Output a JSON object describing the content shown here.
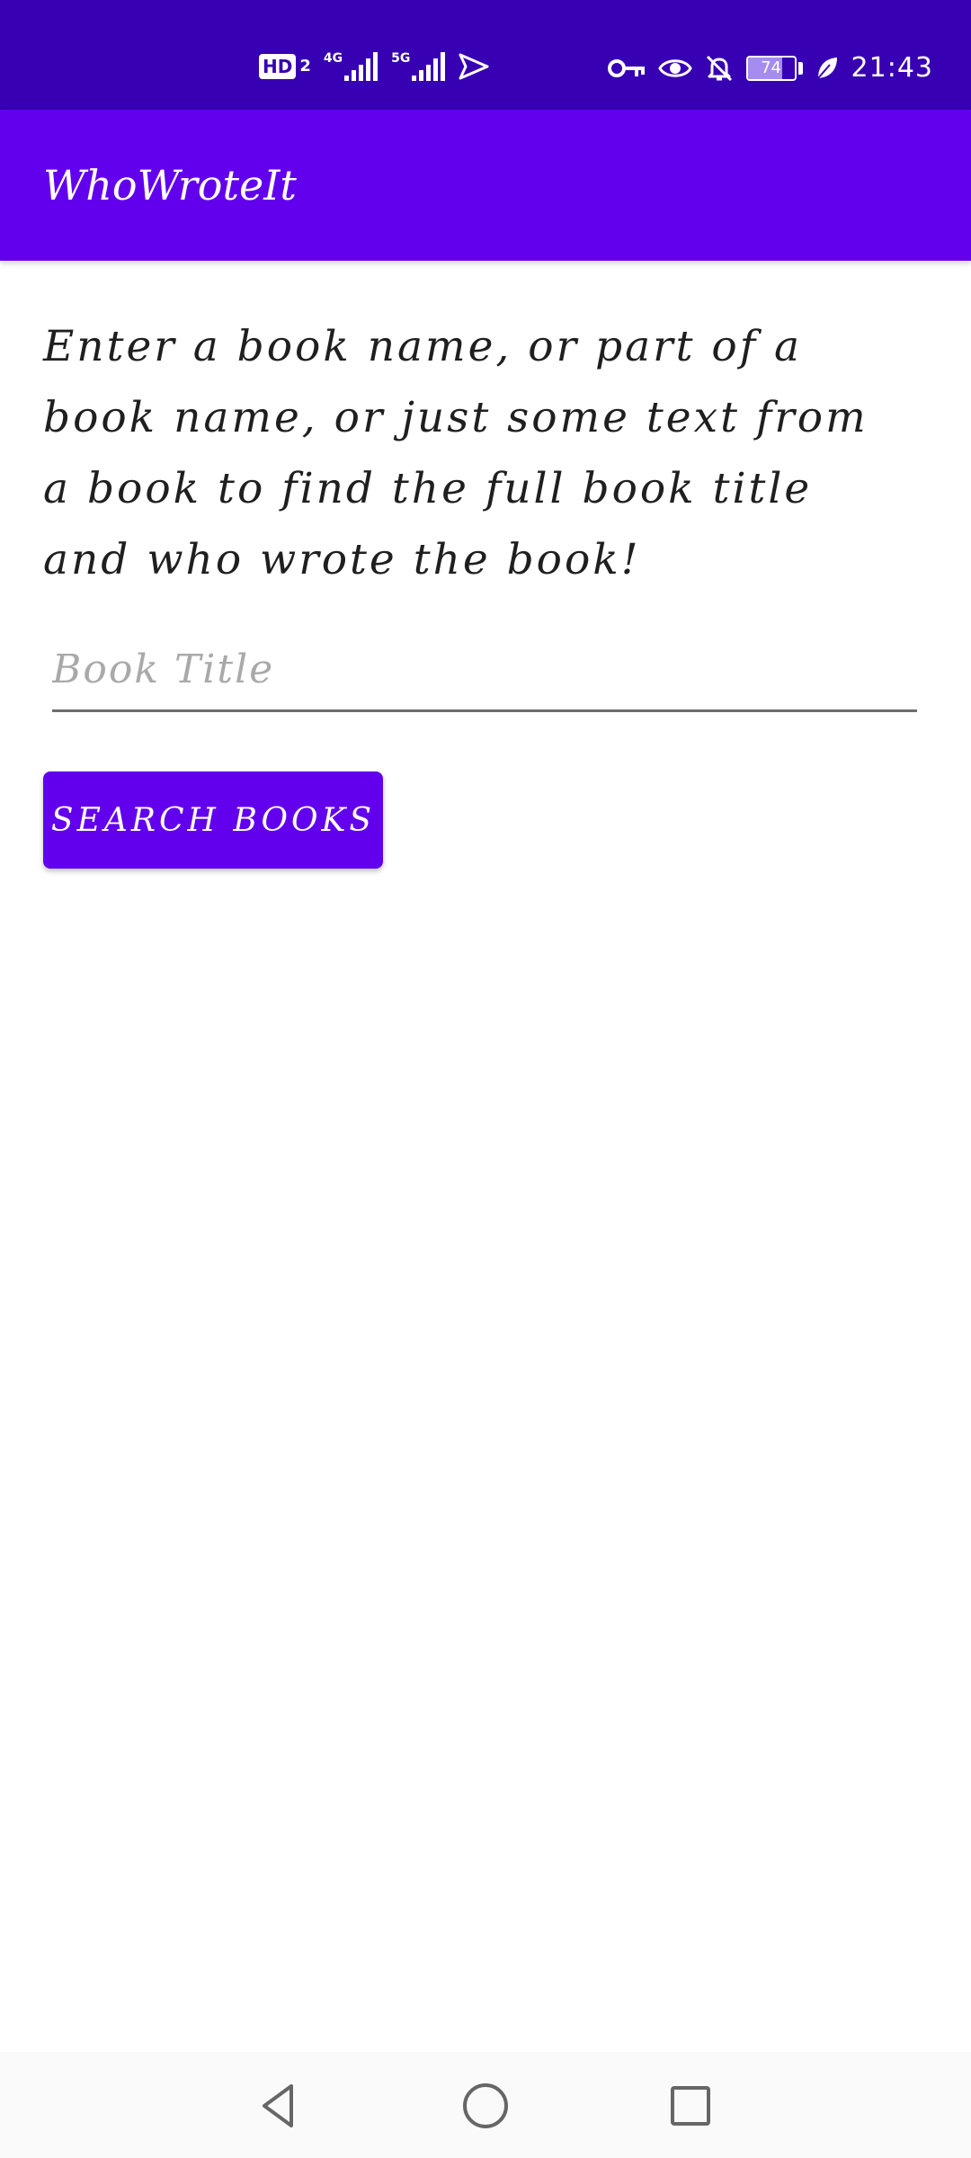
{
  "status_bar": {
    "hd_label": "HD",
    "hd_sub": "2",
    "net1_label": "4G",
    "net2_label": "5G",
    "battery_level": "74",
    "battery_fraction": 0.74,
    "time": "21:43",
    "icons": [
      "signal-icon",
      "send-icon",
      "key-icon",
      "eye-icon",
      "bell-off-icon",
      "battery-icon",
      "leaf-icon"
    ]
  },
  "app_bar": {
    "title": "WhoWroteIt"
  },
  "main": {
    "instructions": "Enter a book name, or part of a book name, or just some text from a book to find the full book title and who wrote the book!",
    "book_input": {
      "placeholder": "Book Title",
      "value": ""
    },
    "search_button_label": "SEARCH BOOKS"
  },
  "nav_bar": {
    "icons": [
      "back-icon",
      "home-icon",
      "recents-icon"
    ]
  },
  "colors": {
    "status_bar": "#3700b3",
    "primary": "#6200ee",
    "background": "#ffffff",
    "nav_bar": "#fafafa"
  }
}
